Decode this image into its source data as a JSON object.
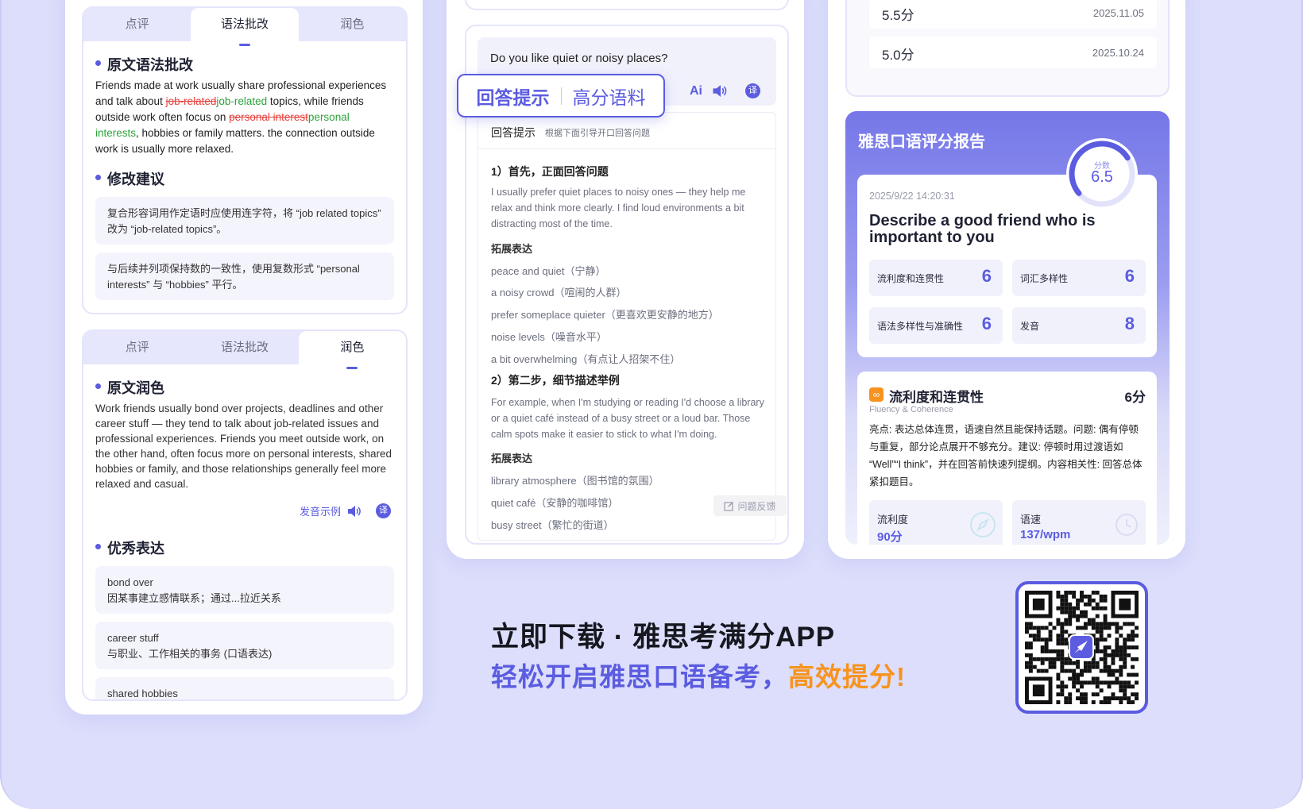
{
  "left_top": {
    "tabs": [
      "点评",
      "语法批改",
      "润色"
    ],
    "section1": "原文语法批改",
    "g": {
      "p1": "Friends made at work usually share professional experiences and talk about ",
      "del1": "job-related",
      "ins1": "job-related",
      "p2": " topics, while friends outside work often focus on ",
      "del2": "personal interest",
      "ins2": "personal interests",
      "p3": ", hobbies or family matters. the connection outside work is usually more relaxed."
    },
    "section2": "修改建议",
    "sugg1": "复合形容词用作定语时应使用连字符，将 “job related topics” 改为 “job-related topics”。",
    "sugg2": "与后续并列项保持数的一致性，使用复数形式 “personal interests” 与 “hobbies” 平行。"
  },
  "left_bottom": {
    "tabs": [
      "点评",
      "语法批改",
      "润色"
    ],
    "section1": "原文润色",
    "polish": "Work friends usually bond over projects, deadlines and other career stuff — they tend to talk about job-related issues and professional experiences. Friends you meet outside work, on the other hand, often focus more on personal interests, shared hobbies or family, and those relationships generally feel more relaxed and casual.",
    "pron": "发音示例",
    "translate": "译",
    "section2": "优秀表达",
    "expr": [
      {
        "en": "bond over",
        "zh": "因某事建立感情联系；通过...拉近关系"
      },
      {
        "en": "career stuff",
        "zh": "与职业、工作相关的事务 (口语表达)"
      },
      {
        "en": "shared hobbies",
        "zh": ""
      }
    ]
  },
  "middle": {
    "question": "Do you like quiet or noisy places?",
    "callout_a": "回答提示",
    "callout_b": "高分语料",
    "ai": "Ai",
    "translate": "译",
    "hint_title": "回答提示",
    "hint_sub": "根据下面引导开口回答问题",
    "step1": "1）首先，正面回答问题",
    "ans1": "I usually prefer quiet places to noisy ones — they help me relax and think more clearly. I find loud environments a bit distracting most of the time.",
    "ext": "拓展表达",
    "list1": [
      "peace and quiet（宁静）",
      "a noisy crowd（喧闹的人群）",
      "prefer someplace quieter（更喜欢更安静的地方）",
      "noise levels（噪音水平）",
      "a bit overwhelming（有点让人招架不住）"
    ],
    "step2": "2）第二步，细节描述举例",
    "ans2": "For example, when I'm studying or reading I'd choose a library or a quiet café instead of a busy street or a loud bar. Those calm spots make it easier to stick to what I'm doing.",
    "list2": [
      "library atmosphere（图书馆的氛围）",
      "quiet café（安静的咖啡馆）",
      "busy street（繁忙的街道）"
    ],
    "feedback": "问题反馈"
  },
  "right": {
    "history": [
      {
        "score": "5.5分",
        "date": "2025.11.05"
      },
      {
        "score": "5.0分",
        "date": "2025.10.24"
      }
    ],
    "report_title": "雅思口语评分报告",
    "score_label": "分数",
    "score": 6.5,
    "score_max": 9,
    "date": "2025/9/22 14:20:31",
    "topic": "Describe a good friend who is important to you",
    "metrics": [
      {
        "label": "流利度和连贯性",
        "value": "6"
      },
      {
        "label": "词汇多样性",
        "value": "6"
      },
      {
        "label": "语法多样性与准确性",
        "value": "6"
      },
      {
        "label": "发音",
        "value": "8"
      }
    ],
    "detail_title": "流利度和连贯性",
    "detail_score": "6分",
    "detail_en": "Fluency & Coherence",
    "detail_text": "亮点: 表达总体连贯，语速自然且能保持话题。问题: 偶有停顿与重复，部分论点展开不够充分。建议: 停顿时用过渡语如 “Well”“I think”，并在回答前快速列提纲。内容相关性: 回答总体紧扣题目。",
    "fluency_label": "流利度",
    "fluency_value": "90分",
    "speed_label": "语速",
    "speed_value": "137/wpm"
  },
  "promo": {
    "line1": "立即下载 · 雅思考满分APP",
    "line2a": "轻松开启雅思口语备考，",
    "line2b": "高效提分!"
  },
  "colors": {
    "accent": "#5b5ce0",
    "orange": "#f7931e",
    "bg": "#dcdefb"
  }
}
